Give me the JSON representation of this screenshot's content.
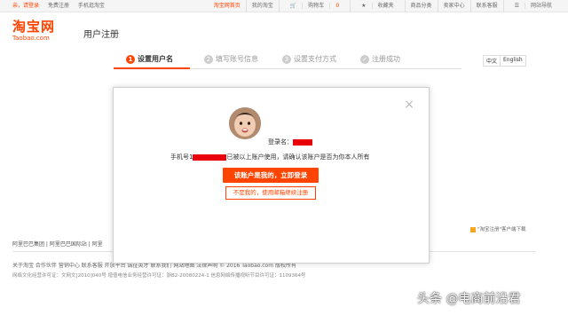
{
  "topbar": {
    "greeting": "亲，请登录",
    "register": "免费注册",
    "mobile": "手机逛淘宝",
    "right_items": [
      "淘宝网首页",
      "我的淘宝",
      "购物车",
      "收藏夹",
      "商品分类",
      "卖家中心",
      "联系客服",
      "网站导航"
    ],
    "cart_count": "0"
  },
  "header": {
    "logo_cn": "淘宝网",
    "logo_en": "Taobao.com",
    "page_title": "用户注册"
  },
  "steps": [
    {
      "num": "1",
      "label": "设置用户名"
    },
    {
      "num": "2",
      "label": "填写账号信息"
    },
    {
      "num": "3",
      "label": "设置支付方式"
    },
    {
      "num": "✓",
      "label": "注册成功"
    }
  ],
  "languages": [
    "中文",
    "English"
  ],
  "modal": {
    "login_name_label": "登录名：",
    "phone_prefix": "手机号1",
    "phone_suffix": "已被以上账户使用，请确认该账户是否为你本人所有",
    "primary_button": "该账户是我的，立即登录",
    "secondary_button": "不是我的，使用邮箱继续注册",
    "close_symbol": "×"
  },
  "background_footer": {
    "links_row": "阿里巴巴集团 | 阿里巴巴国际站 | 阿里",
    "bottom_links": "关于淘宝  合作伙伴  营销中心  联系客服  开放平台  诚征英才  联系我们  网站地图  法律声明        © 2016 Taobao.com 版权所有",
    "license_row": "网络文化经营许可证：文网文[2010]040号   增值电信业务经营许可证：浙B2-20080224-1   信息网络传播视听节目许可证：1109364号",
    "right_note": "\"淘宝注册\"客户端下载"
  },
  "watermark": "头条 @电商前沿君",
  "colors": {
    "accent": "#ff4400",
    "redaction": "#e8000b"
  }
}
